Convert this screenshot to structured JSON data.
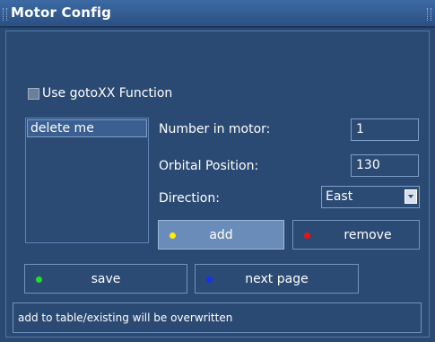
{
  "window": {
    "title": "Motor Config"
  },
  "options": {
    "use_gotoxx_label": "Use gotoXX Function",
    "use_gotoxx_checked": false
  },
  "list": {
    "items": [
      "delete me"
    ]
  },
  "fields": {
    "number_in_motor": {
      "label": "Number in motor:",
      "value": "1"
    },
    "orbital_position": {
      "label": "Orbital Position:",
      "value": "130"
    },
    "direction": {
      "label": "Direction:",
      "value": "East"
    }
  },
  "buttons": {
    "add": {
      "label": "add",
      "color": "#ffee00"
    },
    "remove": {
      "label": "remove",
      "color": "#ee1111"
    },
    "save": {
      "label": "save",
      "color": "#22dd22"
    },
    "next_page": {
      "label": "next page",
      "color": "#1133ee"
    }
  },
  "status": {
    "text": "add to table/existing will be overwritten"
  }
}
